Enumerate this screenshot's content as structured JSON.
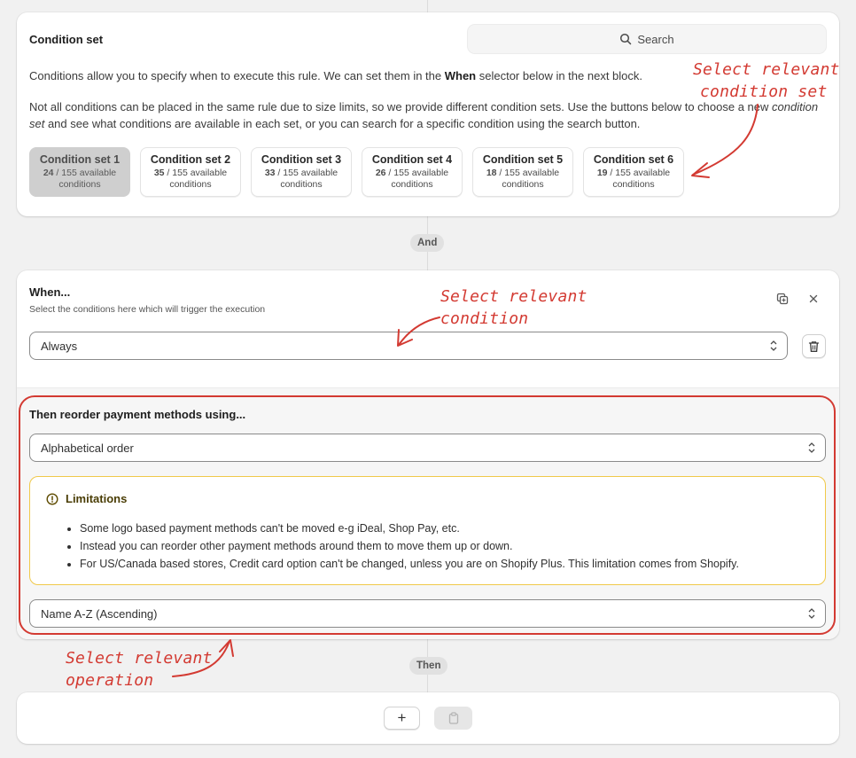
{
  "condition_set": {
    "title": "Condition set",
    "search_placeholder": "Search",
    "desc1_pre": "Conditions allow you to specify when to execute this rule. We can set them in the ",
    "desc1_bold": "When",
    "desc1_post": " selector below in the next block.",
    "desc2_pre": "Not all conditions can be placed in the same rule due to size limits, so we provide different condition sets. Use the buttons below to choose a new ",
    "desc2_italic": "condition set",
    "desc2_post": " and see what conditions are available in each set, or you can search for a specific condition using the search button.",
    "sets": [
      {
        "name": "Condition set 1",
        "count": "24",
        "suffix": " / 155 available",
        "line2": "conditions",
        "active": true
      },
      {
        "name": "Condition set 2",
        "count": "35",
        "suffix": " / 155 available",
        "line2": "conditions",
        "active": false
      },
      {
        "name": "Condition set 3",
        "count": "33",
        "suffix": " / 155 available",
        "line2": "conditions",
        "active": false
      },
      {
        "name": "Condition set 4",
        "count": "26",
        "suffix": " / 155 available",
        "line2": "conditions",
        "active": false
      },
      {
        "name": "Condition set 5",
        "count": "18",
        "suffix": " / 155 available",
        "line2": "conditions",
        "active": false
      },
      {
        "name": "Condition set 6",
        "count": "19",
        "suffix": " / 155 available",
        "line2": "conditions",
        "active": false
      }
    ]
  },
  "and_label": "And",
  "when": {
    "title": "When...",
    "subtitle": "Select the conditions here which will trigger the execution",
    "condition_value": "Always"
  },
  "then_section": {
    "title": "Then reorder payment methods using...",
    "order_value": "Alphabetical order",
    "limitations_title": "Limitations",
    "limitations": [
      "Some logo based payment methods can't be moved e-g iDeal, Shop Pay, etc.",
      "Instead you can reorder other payment methods around them to move them up or down.",
      "For US/Canada based stores, Credit card option can't be changed, unless you are on Shopify Plus. This limitation comes from Shopify."
    ],
    "sort_value": "Name A-Z (Ascending)"
  },
  "then_label": "Then",
  "bottom": {
    "add_label": "+"
  },
  "annotations": {
    "condition_set_line1": "Select relevant",
    "condition_set_line2": "condition set",
    "condition_line1": "Select relevant",
    "condition_line2": "condition",
    "operation_line1": "Select relevant",
    "operation_line2": "operation"
  },
  "colors": {
    "annotation": "#d33a32",
    "warning_border": "#f0c94a",
    "active_set": "#cfcfcf"
  }
}
